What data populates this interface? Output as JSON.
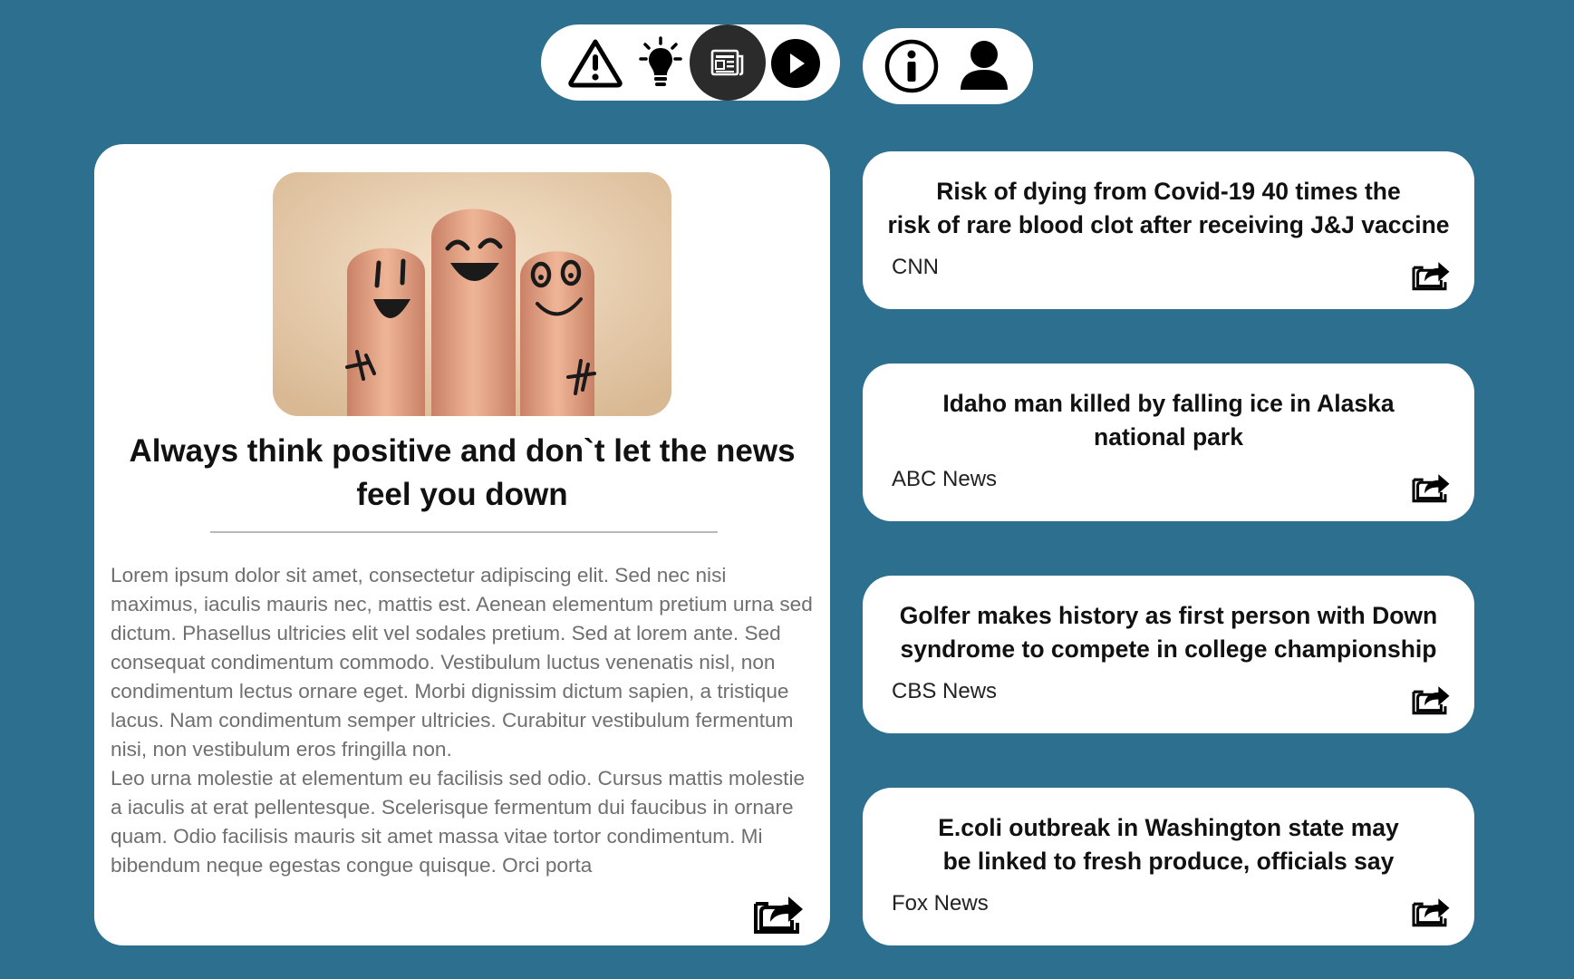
{
  "nav": {
    "main_icons": [
      "warning-triangle-icon",
      "lightbulb-icon",
      "newspaper-icon",
      "play-icon"
    ],
    "active_icon": "newspaper-icon",
    "secondary_icons": [
      "info-icon",
      "user-icon"
    ]
  },
  "featured": {
    "image_icon": "smiling-fingers-photo",
    "title": "Always think positive and don`t let the news feel you down",
    "body_paragraphs": [
      "Lorem ipsum dolor sit amet, consectetur adipiscing elit. Sed nec nisi maximus, iaculis mauris nec, mattis est. Aenean elementum pretium urna sed dictum. Phasellus ultricies elit vel sodales pretium. Sed at lorem ante. Sed consequat condimentum commodo. Vestibulum luctus venenatis nisl, non condimentum lectus ornare eget. Morbi dignissim dictum sapien, a tristique lacus. Nam condimentum semper ultricies. Curabitur vestibulum fermentum nisi, non vestibulum eros fringilla non.",
      "Leo urna molestie at elementum eu facilisis sed odio. Cursus mattis molestie a iaculis at erat pellentesque. Scelerisque fermentum dui faucibus in ornare quam. Odio facilisis mauris sit amet massa vitae tortor condimentum. Mi bibendum neque egestas congue quisque. Orci porta"
    ],
    "share_icon": "share-icon"
  },
  "news": [
    {
      "title_lines": [
        "Risk of dying from Covid-19 40 times the",
        "risk of rare blood clot after receiving J&J vaccine"
      ],
      "source": "CNN"
    },
    {
      "title_lines": [
        "Idaho man killed by falling ice in Alaska",
        "national park"
      ],
      "source": "ABC News"
    },
    {
      "title_lines": [
        "Golfer makes history as first person with Down",
        "syndrome to compete in college championship"
      ],
      "source": "CBS News"
    },
    {
      "title_lines": [
        "E.coli outbreak in Washington state may",
        "be linked to fresh produce, officials say"
      ],
      "source": "Fox News"
    }
  ],
  "colors": {
    "background": "#2c6f8e",
    "card": "#ffffff",
    "active_nav": "#2b2b2b",
    "body_text": "#6f6f6f"
  }
}
